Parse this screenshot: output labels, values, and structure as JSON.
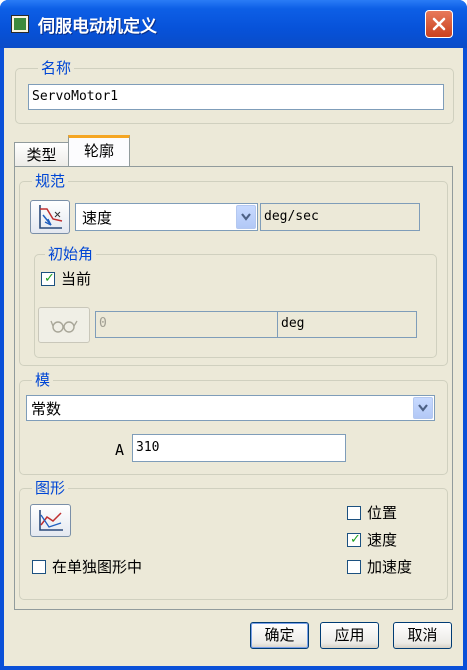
{
  "window": {
    "title": "伺服电动机定义"
  },
  "name_group": {
    "title": "名称",
    "value": "ServoMotor1"
  },
  "tabs": [
    {
      "label": "类型"
    },
    {
      "label": "轮廓"
    }
  ],
  "spec_group": {
    "title": "规范",
    "selected": "速度",
    "unit": "deg/sec"
  },
  "initial_angle": {
    "title": "初始角",
    "current_label": "当前",
    "current_checked": true,
    "value": "0",
    "unit": "deg"
  },
  "mode_group": {
    "title": "模",
    "selected": "常数",
    "param_label": "A",
    "param_value": "310"
  },
  "graph_group": {
    "title": "图形",
    "separate_label": "在单独图形中",
    "separate_checked": false,
    "options": [
      {
        "label": "位置",
        "checked": false
      },
      {
        "label": "速度",
        "checked": true
      },
      {
        "label": "加速度",
        "checked": false
      }
    ]
  },
  "buttons": {
    "ok": "确定",
    "apply": "应用",
    "cancel": "取消"
  }
}
